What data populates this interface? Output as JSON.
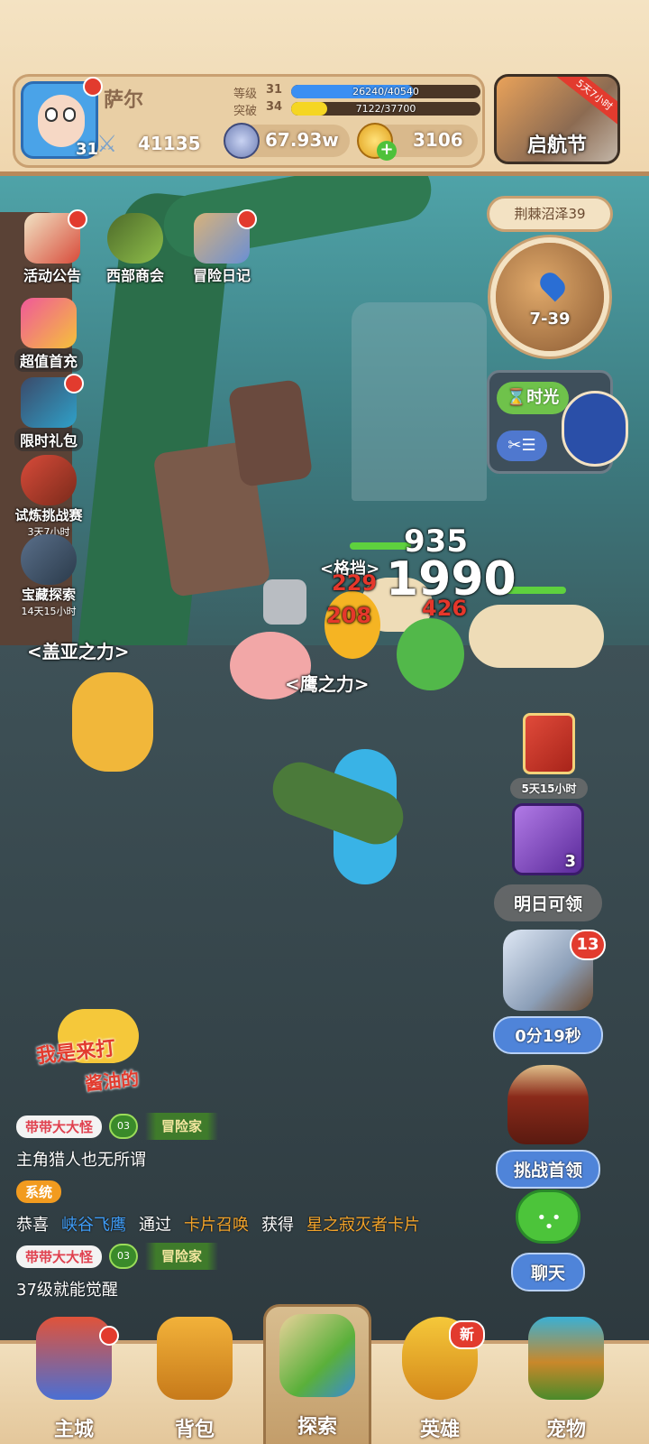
{
  "player": {
    "name": "萨尔",
    "avatar_level": "31",
    "power": "41135",
    "level_label": "等级",
    "level": "31",
    "exp_text": "26240/40540",
    "exp_fraction": 0.647,
    "break_label": "突破",
    "break_level": "34",
    "break_text": "7122/37700",
    "break_fraction": 0.189
  },
  "currencies": {
    "silver": "67.93w",
    "gold": "3106"
  },
  "festival": {
    "label": "启航节",
    "timer_tag": "5天7小时"
  },
  "left_menu": [
    {
      "label": "活动公告",
      "sub": ""
    },
    {
      "label": "西部商会",
      "sub": ""
    },
    {
      "label": "冒险日记",
      "sub": ""
    },
    {
      "label": "超值首充",
      "sub": ""
    },
    {
      "label": "限时礼包",
      "sub": ""
    },
    {
      "label": "试炼挑战赛",
      "sub": "3天7小时"
    },
    {
      "label": "宝藏探索",
      "sub": "14天15小时"
    }
  ],
  "map": {
    "zone_name": "荆棘沼泽39",
    "stage": "7-39",
    "timelight_label": "时光",
    "small_btn_label": "✂☰"
  },
  "battle": {
    "skill_block": "<格挡>",
    "skill_gaia": "<盖亚之力>",
    "skill_hawk": "<鹰之力>",
    "dmg_big": "1990",
    "dmg_a": "935",
    "dmg_b": "229",
    "dmg_c": "208",
    "dmg_d": "426"
  },
  "right_column": {
    "gift_timer": "5天15小时",
    "chest_count": "3",
    "tomorrow_label": "明日可领",
    "treasure_badge": "13",
    "treasure_timer": "0分19秒",
    "boss_label": "挑战首领",
    "chat_label": "聊天"
  },
  "sticker": {
    "line1": "我是来打",
    "line2": "酱油的"
  },
  "chat": [
    {
      "type": "user",
      "name": "带带大大怪",
      "level": "03",
      "title": "冒险家",
      "message": "主角猎人也无所谓"
    },
    {
      "type": "system",
      "tag": "系统",
      "parts": [
        "恭喜",
        "峡谷飞鹰",
        "通过",
        "卡片召唤",
        "获得",
        "星之寂灭者卡片"
      ]
    },
    {
      "type": "user",
      "name": "带带大大怪",
      "level": "03",
      "title": "冒险家",
      "message": "37级就能觉醒"
    }
  ],
  "bottom_nav": [
    {
      "label": "主城"
    },
    {
      "label": "背包"
    },
    {
      "label": "探索"
    },
    {
      "label": "英雄",
      "badge": "新"
    },
    {
      "label": "宠物"
    }
  ],
  "colors": {
    "exp_bar": "#3b8ff2",
    "break_bar": "#f5d623",
    "hp_green": "#5ed13e",
    "damage_red": "#e5372b",
    "damage_white": "#ffffff"
  }
}
